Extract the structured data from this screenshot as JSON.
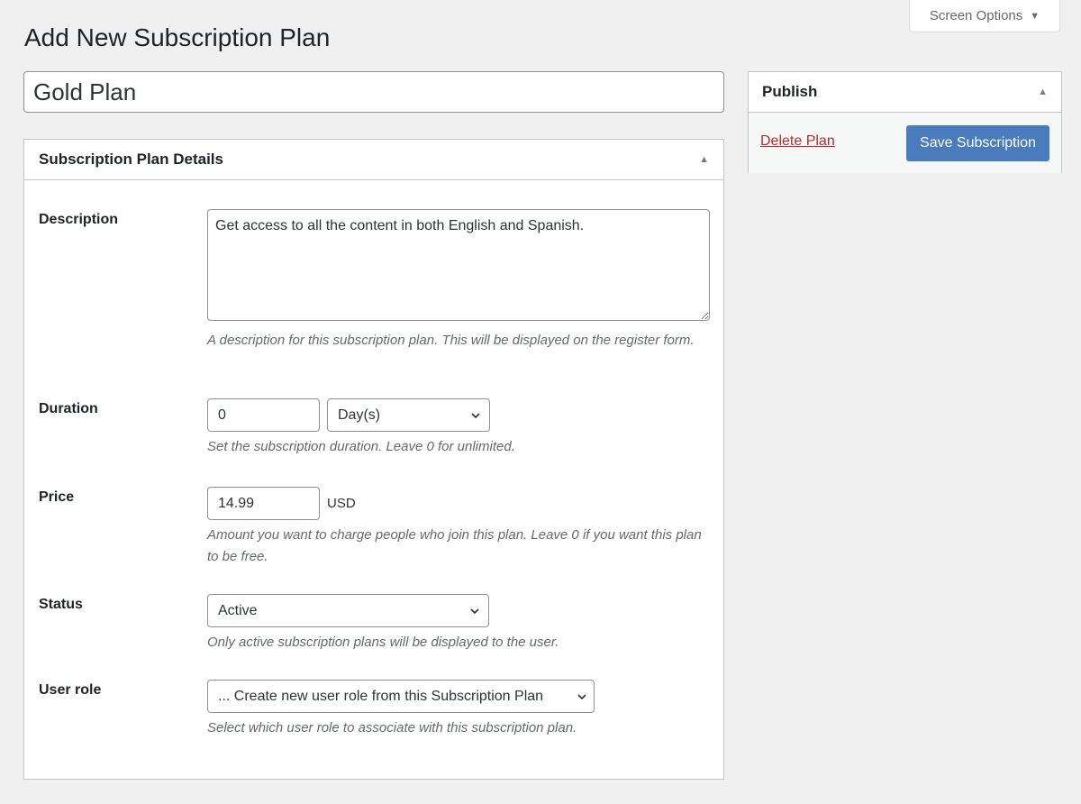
{
  "screen_options": {
    "label": "Screen Options"
  },
  "page_title": "Add New Subscription Plan",
  "plan_name": {
    "value": "Gold Plan",
    "placeholder": ""
  },
  "details_box": {
    "title": "Subscription Plan Details",
    "fields": {
      "description": {
        "label": "Description",
        "value": "Get access to all the content in both English and Spanish.",
        "help": "A description for this subscription plan. This will be displayed on the register form."
      },
      "duration": {
        "label": "Duration",
        "value": "0",
        "unit": "Day(s)",
        "help": "Set the subscription duration. Leave 0 for unlimited."
      },
      "price": {
        "label": "Price",
        "value": "14.99",
        "currency": "USD",
        "help": "Amount you want to charge people who join this plan. Leave 0 if you want this plan to be free."
      },
      "status": {
        "label": "Status",
        "value": "Active",
        "help": "Only active subscription plans will be displayed to the user."
      },
      "user_role": {
        "label": "User role",
        "value": "... Create new user role from this Subscription Plan",
        "help": "Select which user role to associate with this subscription plan."
      }
    }
  },
  "publish_box": {
    "title": "Publish",
    "delete_label": "Delete Plan",
    "save_label": "Save Subscription"
  },
  "colors": {
    "background": "#f0f0f1",
    "primary_button": "#4a7bbd",
    "delete_link": "#b32d2e"
  }
}
